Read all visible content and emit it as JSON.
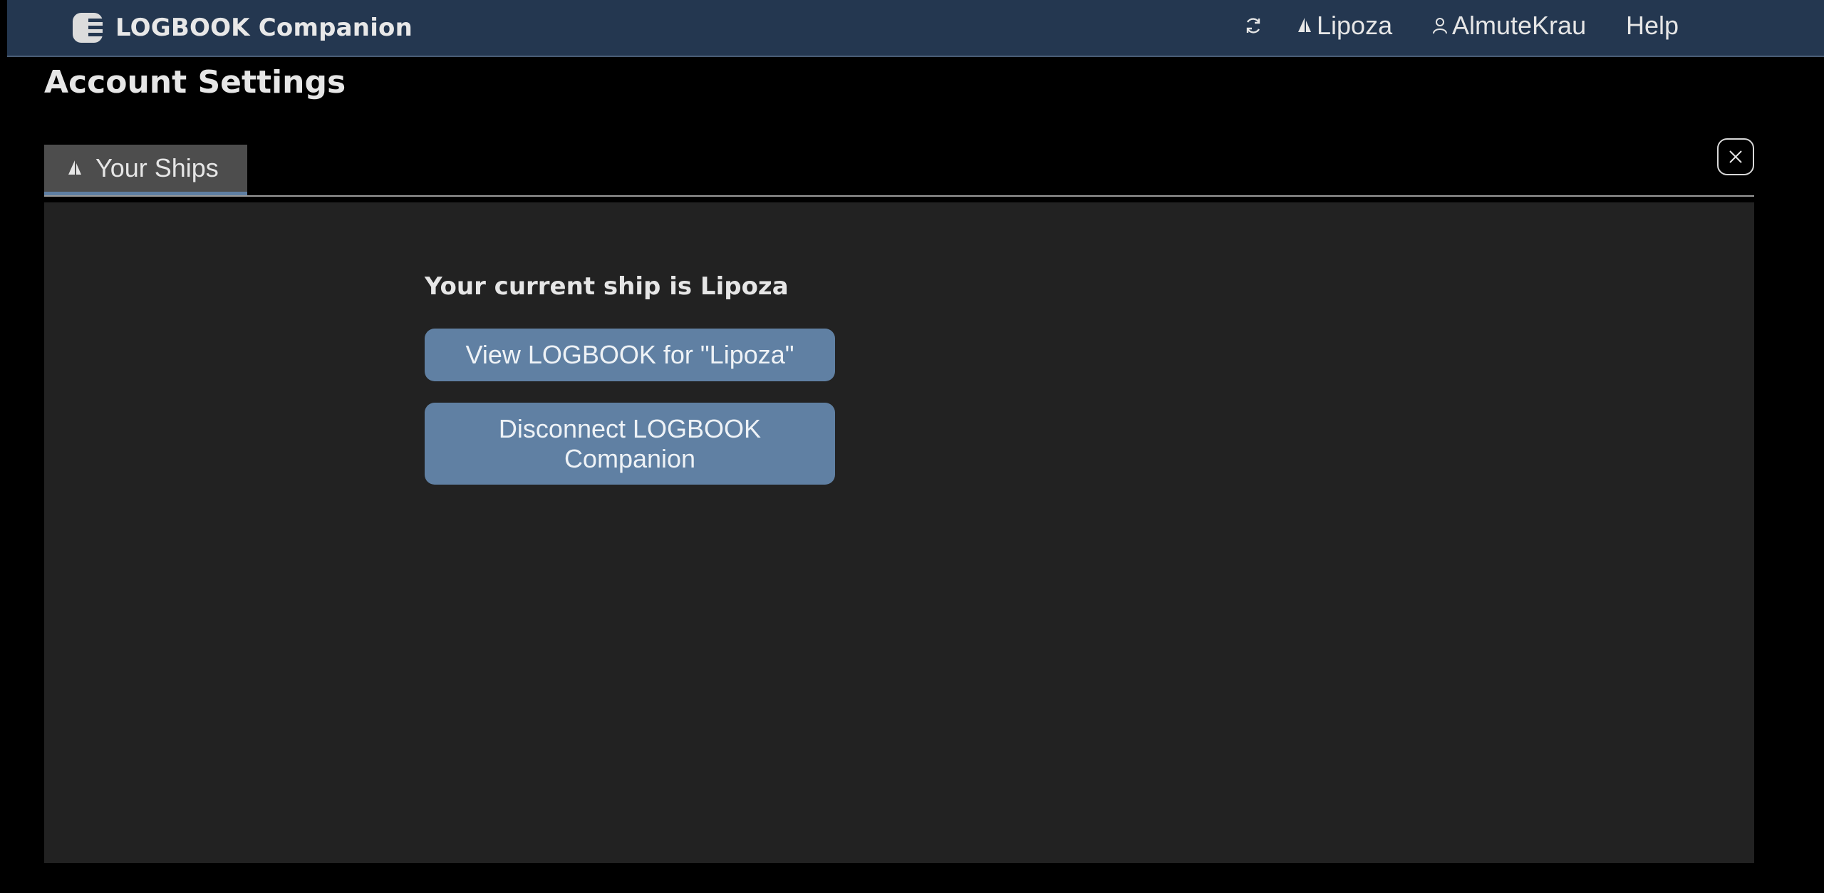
{
  "app": {
    "title": "LOGBOOK Companion"
  },
  "nav": {
    "refresh_icon": "refresh-icon",
    "ship_label": "Lipoza",
    "ship_icon": "sailboat-icon",
    "user_label": "AlmuteKrau",
    "user_icon": "user-icon",
    "help_label": "Help"
  },
  "page": {
    "title": "Account Settings"
  },
  "tabs": [
    {
      "label": "Your Ships",
      "icon": "sailboat-icon",
      "active": true
    }
  ],
  "panel": {
    "current_ship_text": "Your current ship is Lipoza",
    "view_button": "View LOGBOOK for \"Lipoza\"",
    "disconnect_button": "Disconnect LOGBOOK Companion"
  },
  "colors": {
    "topbar": "#243750",
    "accent": "#6080a3",
    "panel": "#222222",
    "tab": "#4d4d4d"
  }
}
